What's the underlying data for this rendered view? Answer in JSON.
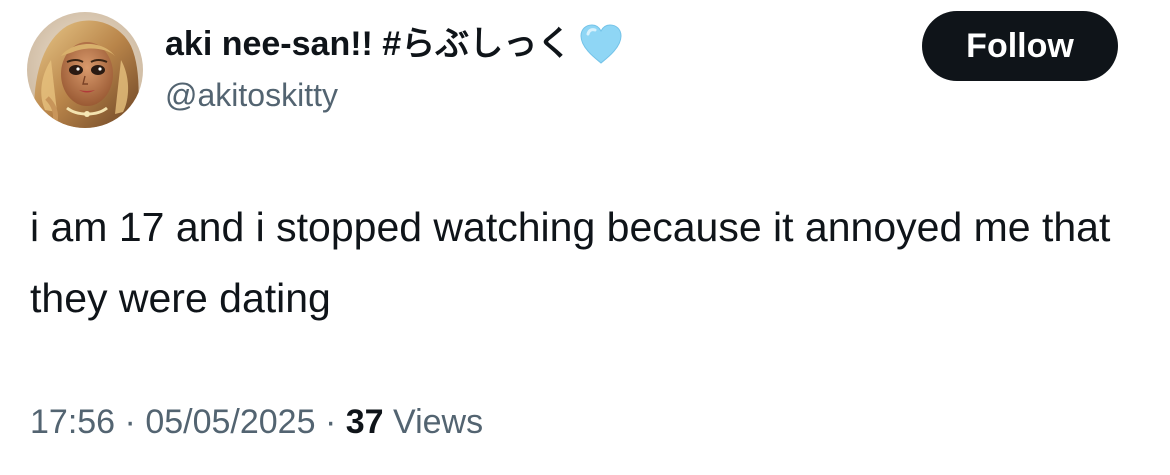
{
  "user": {
    "display_name": "aki nee-san!! #らぶしっく",
    "handle": "@akitoskitty",
    "name_emoji": "light-blue-heart",
    "heart_color": "#8fd6f5"
  },
  "follow_button": {
    "label": "Follow"
  },
  "tweet": {
    "text": "i am 17 and i stopped watching because it annoyed me that they were dating"
  },
  "meta": {
    "time": "17:56",
    "separator": "·",
    "date": "05/05/2025",
    "views_count": "37",
    "views_label": "Views"
  }
}
